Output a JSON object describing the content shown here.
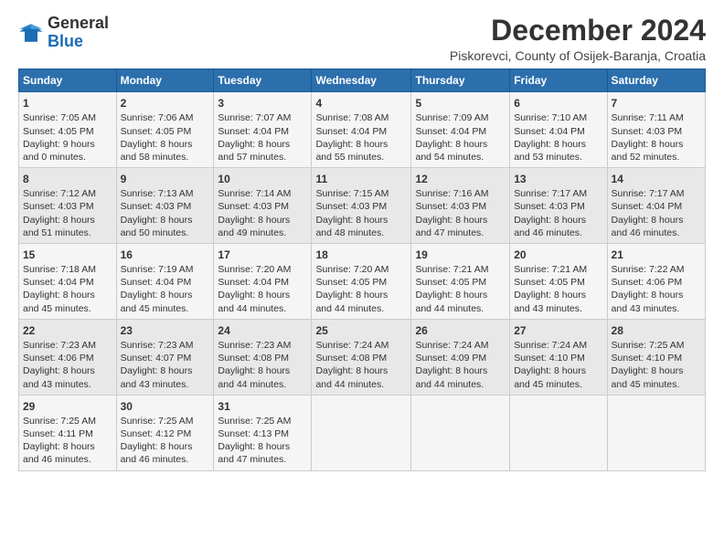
{
  "logo": {
    "line1": "General",
    "line2": "Blue"
  },
  "title": "December 2024",
  "subtitle": "Piskorevci, County of Osijek-Baranja, Croatia",
  "days_header": [
    "Sunday",
    "Monday",
    "Tuesday",
    "Wednesday",
    "Thursday",
    "Friday",
    "Saturday"
  ],
  "weeks": [
    [
      {
        "day": "1",
        "lines": [
          "Sunrise: 7:05 AM",
          "Sunset: 4:05 PM",
          "Daylight: 9 hours",
          "and 0 minutes."
        ]
      },
      {
        "day": "2",
        "lines": [
          "Sunrise: 7:06 AM",
          "Sunset: 4:05 PM",
          "Daylight: 8 hours",
          "and 58 minutes."
        ]
      },
      {
        "day": "3",
        "lines": [
          "Sunrise: 7:07 AM",
          "Sunset: 4:04 PM",
          "Daylight: 8 hours",
          "and 57 minutes."
        ]
      },
      {
        "day": "4",
        "lines": [
          "Sunrise: 7:08 AM",
          "Sunset: 4:04 PM",
          "Daylight: 8 hours",
          "and 55 minutes."
        ]
      },
      {
        "day": "5",
        "lines": [
          "Sunrise: 7:09 AM",
          "Sunset: 4:04 PM",
          "Daylight: 8 hours",
          "and 54 minutes."
        ]
      },
      {
        "day": "6",
        "lines": [
          "Sunrise: 7:10 AM",
          "Sunset: 4:04 PM",
          "Daylight: 8 hours",
          "and 53 minutes."
        ]
      },
      {
        "day": "7",
        "lines": [
          "Sunrise: 7:11 AM",
          "Sunset: 4:03 PM",
          "Daylight: 8 hours",
          "and 52 minutes."
        ]
      }
    ],
    [
      {
        "day": "8",
        "lines": [
          "Sunrise: 7:12 AM",
          "Sunset: 4:03 PM",
          "Daylight: 8 hours",
          "and 51 minutes."
        ]
      },
      {
        "day": "9",
        "lines": [
          "Sunrise: 7:13 AM",
          "Sunset: 4:03 PM",
          "Daylight: 8 hours",
          "and 50 minutes."
        ]
      },
      {
        "day": "10",
        "lines": [
          "Sunrise: 7:14 AM",
          "Sunset: 4:03 PM",
          "Daylight: 8 hours",
          "and 49 minutes."
        ]
      },
      {
        "day": "11",
        "lines": [
          "Sunrise: 7:15 AM",
          "Sunset: 4:03 PM",
          "Daylight: 8 hours",
          "and 48 minutes."
        ]
      },
      {
        "day": "12",
        "lines": [
          "Sunrise: 7:16 AM",
          "Sunset: 4:03 PM",
          "Daylight: 8 hours",
          "and 47 minutes."
        ]
      },
      {
        "day": "13",
        "lines": [
          "Sunrise: 7:17 AM",
          "Sunset: 4:03 PM",
          "Daylight: 8 hours",
          "and 46 minutes."
        ]
      },
      {
        "day": "14",
        "lines": [
          "Sunrise: 7:17 AM",
          "Sunset: 4:04 PM",
          "Daylight: 8 hours",
          "and 46 minutes."
        ]
      }
    ],
    [
      {
        "day": "15",
        "lines": [
          "Sunrise: 7:18 AM",
          "Sunset: 4:04 PM",
          "Daylight: 8 hours",
          "and 45 minutes."
        ]
      },
      {
        "day": "16",
        "lines": [
          "Sunrise: 7:19 AM",
          "Sunset: 4:04 PM",
          "Daylight: 8 hours",
          "and 45 minutes."
        ]
      },
      {
        "day": "17",
        "lines": [
          "Sunrise: 7:20 AM",
          "Sunset: 4:04 PM",
          "Daylight: 8 hours",
          "and 44 minutes."
        ]
      },
      {
        "day": "18",
        "lines": [
          "Sunrise: 7:20 AM",
          "Sunset: 4:05 PM",
          "Daylight: 8 hours",
          "and 44 minutes."
        ]
      },
      {
        "day": "19",
        "lines": [
          "Sunrise: 7:21 AM",
          "Sunset: 4:05 PM",
          "Daylight: 8 hours",
          "and 44 minutes."
        ]
      },
      {
        "day": "20",
        "lines": [
          "Sunrise: 7:21 AM",
          "Sunset: 4:05 PM",
          "Daylight: 8 hours",
          "and 43 minutes."
        ]
      },
      {
        "day": "21",
        "lines": [
          "Sunrise: 7:22 AM",
          "Sunset: 4:06 PM",
          "Daylight: 8 hours",
          "and 43 minutes."
        ]
      }
    ],
    [
      {
        "day": "22",
        "lines": [
          "Sunrise: 7:23 AM",
          "Sunset: 4:06 PM",
          "Daylight: 8 hours",
          "and 43 minutes."
        ]
      },
      {
        "day": "23",
        "lines": [
          "Sunrise: 7:23 AM",
          "Sunset: 4:07 PM",
          "Daylight: 8 hours",
          "and 43 minutes."
        ]
      },
      {
        "day": "24",
        "lines": [
          "Sunrise: 7:23 AM",
          "Sunset: 4:08 PM",
          "Daylight: 8 hours",
          "and 44 minutes."
        ]
      },
      {
        "day": "25",
        "lines": [
          "Sunrise: 7:24 AM",
          "Sunset: 4:08 PM",
          "Daylight: 8 hours",
          "and 44 minutes."
        ]
      },
      {
        "day": "26",
        "lines": [
          "Sunrise: 7:24 AM",
          "Sunset: 4:09 PM",
          "Daylight: 8 hours",
          "and 44 minutes."
        ]
      },
      {
        "day": "27",
        "lines": [
          "Sunrise: 7:24 AM",
          "Sunset: 4:10 PM",
          "Daylight: 8 hours",
          "and 45 minutes."
        ]
      },
      {
        "day": "28",
        "lines": [
          "Sunrise: 7:25 AM",
          "Sunset: 4:10 PM",
          "Daylight: 8 hours",
          "and 45 minutes."
        ]
      }
    ],
    [
      {
        "day": "29",
        "lines": [
          "Sunrise: 7:25 AM",
          "Sunset: 4:11 PM",
          "Daylight: 8 hours",
          "and 46 minutes."
        ]
      },
      {
        "day": "30",
        "lines": [
          "Sunrise: 7:25 AM",
          "Sunset: 4:12 PM",
          "Daylight: 8 hours",
          "and 46 minutes."
        ]
      },
      {
        "day": "31",
        "lines": [
          "Sunrise: 7:25 AM",
          "Sunset: 4:13 PM",
          "Daylight: 8 hours",
          "and 47 minutes."
        ]
      },
      null,
      null,
      null,
      null
    ]
  ]
}
